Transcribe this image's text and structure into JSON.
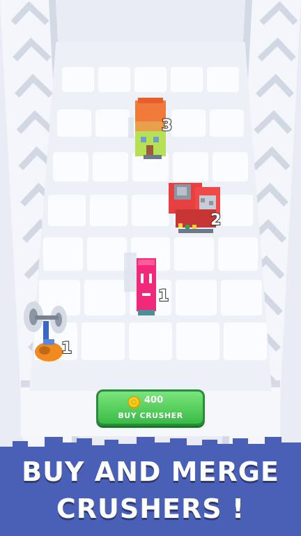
{
  "game": {
    "items": [
      {
        "name": "house-crusher",
        "level": "3"
      },
      {
        "name": "machine-crusher",
        "level": "2"
      },
      {
        "name": "pink-crusher",
        "level": "1"
      },
      {
        "name": "saw-crusher",
        "level": "1"
      }
    ],
    "buy_button": {
      "price": "400",
      "label": "BUY CRUSHER",
      "icon": "coin-icon"
    },
    "banner": {
      "line1": "BUY AND MERGE",
      "line2": "CRUSHERS !"
    },
    "colors": {
      "banner": "#4a5fb6",
      "button": "#4cc957",
      "board": "#edf0f7"
    }
  }
}
